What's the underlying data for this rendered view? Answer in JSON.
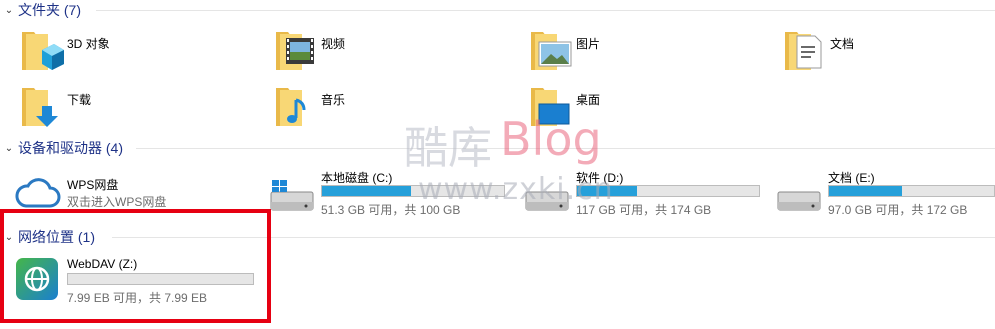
{
  "sections": {
    "folders": {
      "title": "文件夹 (7)"
    },
    "devices": {
      "title": "设备和驱动器 (4)"
    },
    "network": {
      "title": "网络位置 (1)"
    }
  },
  "folders": [
    {
      "label": "3D 对象",
      "icon": "3d-objects-folder-icon"
    },
    {
      "label": "视频",
      "icon": "videos-folder-icon"
    },
    {
      "label": "图片",
      "icon": "pictures-folder-icon"
    },
    {
      "label": "文档",
      "icon": "documents-folder-icon"
    },
    {
      "label": "下载",
      "icon": "downloads-folder-icon"
    },
    {
      "label": "音乐",
      "icon": "music-folder-icon"
    },
    {
      "label": "桌面",
      "icon": "desktop-folder-icon"
    }
  ],
  "wps": {
    "name": "WPS网盘",
    "desc": "双击进入WPS网盘"
  },
  "drives": [
    {
      "name": "本地磁盘 (C:)",
      "space": "51.3 GB 可用，共 100 GB",
      "used_fraction": 0.49
    },
    {
      "name": "软件 (D:)",
      "space": "117 GB 可用，共 174 GB",
      "used_fraction": 0.33
    },
    {
      "name": "文档 (E:)",
      "space": "97.0 GB 可用，共 172 GB",
      "used_fraction": 0.44
    }
  ],
  "network_drive": {
    "name": "WebDAV (Z:)",
    "space": "7.99 EB 可用，共 7.99 EB",
    "used_fraction": 0.0
  },
  "watermark": {
    "brand_cn": "酷库",
    "brand_en": "Blog",
    "url": "www.zxki.cn"
  },
  "colors": {
    "accent": "#1e3287",
    "drive_bar": "#26a0da",
    "highlight_box": "#e60012",
    "folder": "#f8d775"
  }
}
